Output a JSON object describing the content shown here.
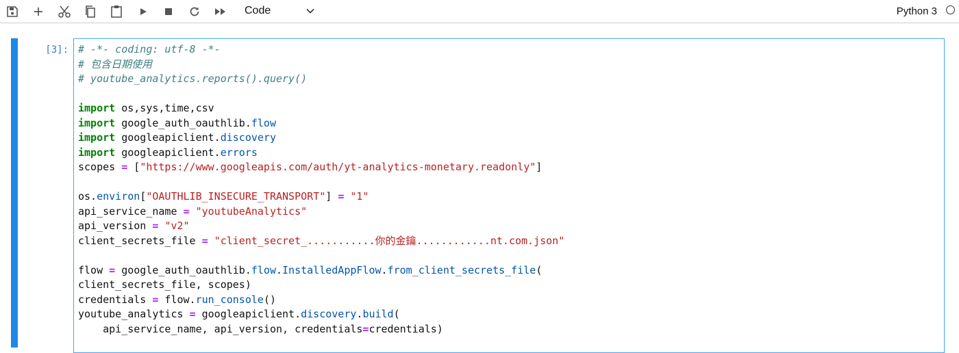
{
  "toolbar": {
    "buttons": [
      {
        "name": "save-icon"
      },
      {
        "name": "add-cell-icon"
      },
      {
        "name": "cut-icon"
      },
      {
        "name": "copy-icon"
      },
      {
        "name": "paste-icon"
      },
      {
        "name": "run-icon"
      },
      {
        "name": "stop-icon"
      },
      {
        "name": "restart-icon"
      },
      {
        "name": "fast-forward-icon"
      }
    ],
    "cell_type": "Code",
    "kernel": "Python 3"
  },
  "cell": {
    "prompt": "[3]:",
    "lines": [
      [
        {
          "t": "# -*- coding: utf-8 -*-",
          "c": "c"
        }
      ],
      [
        {
          "t": "# 包含日期使用",
          "c": "c"
        }
      ],
      [
        {
          "t": "# youtube_analytics.reports().query()",
          "c": "c"
        }
      ],
      [],
      [
        {
          "t": "import",
          "c": "k"
        },
        {
          "t": " os,sys,time,csv",
          "c": "n"
        }
      ],
      [
        {
          "t": "import",
          "c": "k"
        },
        {
          "t": " google_auth_oauthlib.",
          "c": "n"
        },
        {
          "t": "flow",
          "c": "nf"
        }
      ],
      [
        {
          "t": "import",
          "c": "k"
        },
        {
          "t": " googleapiclient.",
          "c": "n"
        },
        {
          "t": "discovery",
          "c": "nf"
        }
      ],
      [
        {
          "t": "import",
          "c": "k"
        },
        {
          "t": " googleapiclient.",
          "c": "n"
        },
        {
          "t": "errors",
          "c": "nf"
        }
      ],
      [
        {
          "t": "scopes ",
          "c": "n"
        },
        {
          "t": "=",
          "c": "o"
        },
        {
          "t": " [",
          "c": "p"
        },
        {
          "t": "\"https://www.googleapis.com/auth/yt-analytics-monetary.readonly\"",
          "c": "s"
        },
        {
          "t": "]",
          "c": "p"
        }
      ],
      [],
      [
        {
          "t": "os.",
          "c": "n"
        },
        {
          "t": "environ",
          "c": "nf"
        },
        {
          "t": "[",
          "c": "p"
        },
        {
          "t": "\"OAUTHLIB_INSECURE_TRANSPORT\"",
          "c": "s"
        },
        {
          "t": "] ",
          "c": "p"
        },
        {
          "t": "=",
          "c": "o"
        },
        {
          "t": " ",
          "c": "n"
        },
        {
          "t": "\"1\"",
          "c": "s"
        }
      ],
      [
        {
          "t": "api_service_name ",
          "c": "n"
        },
        {
          "t": "=",
          "c": "o"
        },
        {
          "t": " ",
          "c": "n"
        },
        {
          "t": "\"youtubeAnalytics\"",
          "c": "s"
        }
      ],
      [
        {
          "t": "api_version ",
          "c": "n"
        },
        {
          "t": "=",
          "c": "o"
        },
        {
          "t": " ",
          "c": "n"
        },
        {
          "t": "\"v2\"",
          "c": "s"
        }
      ],
      [
        {
          "t": "client_secrets_file ",
          "c": "n"
        },
        {
          "t": "=",
          "c": "o"
        },
        {
          "t": " ",
          "c": "n"
        },
        {
          "t": "\"client_secret_...........你的金鑰............nt.com.json\"",
          "c": "s"
        }
      ],
      [],
      [
        {
          "t": "flow ",
          "c": "n"
        },
        {
          "t": "=",
          "c": "o"
        },
        {
          "t": " google_auth_oauthlib.",
          "c": "n"
        },
        {
          "t": "flow",
          "c": "nf"
        },
        {
          "t": ".",
          "c": "n"
        },
        {
          "t": "InstalledAppFlow",
          "c": "nf"
        },
        {
          "t": ".",
          "c": "n"
        },
        {
          "t": "from_client_secrets_file",
          "c": "nf"
        },
        {
          "t": "(",
          "c": "p"
        }
      ],
      [
        {
          "t": "client_secrets_file, scopes)",
          "c": "n"
        }
      ],
      [
        {
          "t": "credentials ",
          "c": "n"
        },
        {
          "t": "=",
          "c": "o"
        },
        {
          "t": " flow.",
          "c": "n"
        },
        {
          "t": "run_console",
          "c": "nf"
        },
        {
          "t": "()",
          "c": "p"
        }
      ],
      [
        {
          "t": "youtube_analytics ",
          "c": "n"
        },
        {
          "t": "=",
          "c": "o"
        },
        {
          "t": " googleapiclient.",
          "c": "n"
        },
        {
          "t": "discovery",
          "c": "nf"
        },
        {
          "t": ".",
          "c": "n"
        },
        {
          "t": "build",
          "c": "nf"
        },
        {
          "t": "(",
          "c": "p"
        }
      ],
      [
        {
          "t": "    api_service_name, api_version, credentials",
          "c": "n"
        },
        {
          "t": "=",
          "c": "o"
        },
        {
          "t": "credentials)",
          "c": "n"
        }
      ]
    ]
  },
  "colors": {
    "accent": "#1e88e5",
    "editor_border": "#42a5f5",
    "prompt": "#307fc1",
    "comment": "#408080",
    "keyword": "#008000",
    "operator": "#aa22ff",
    "string": "#ba2121",
    "attribute": "#0055aa"
  }
}
